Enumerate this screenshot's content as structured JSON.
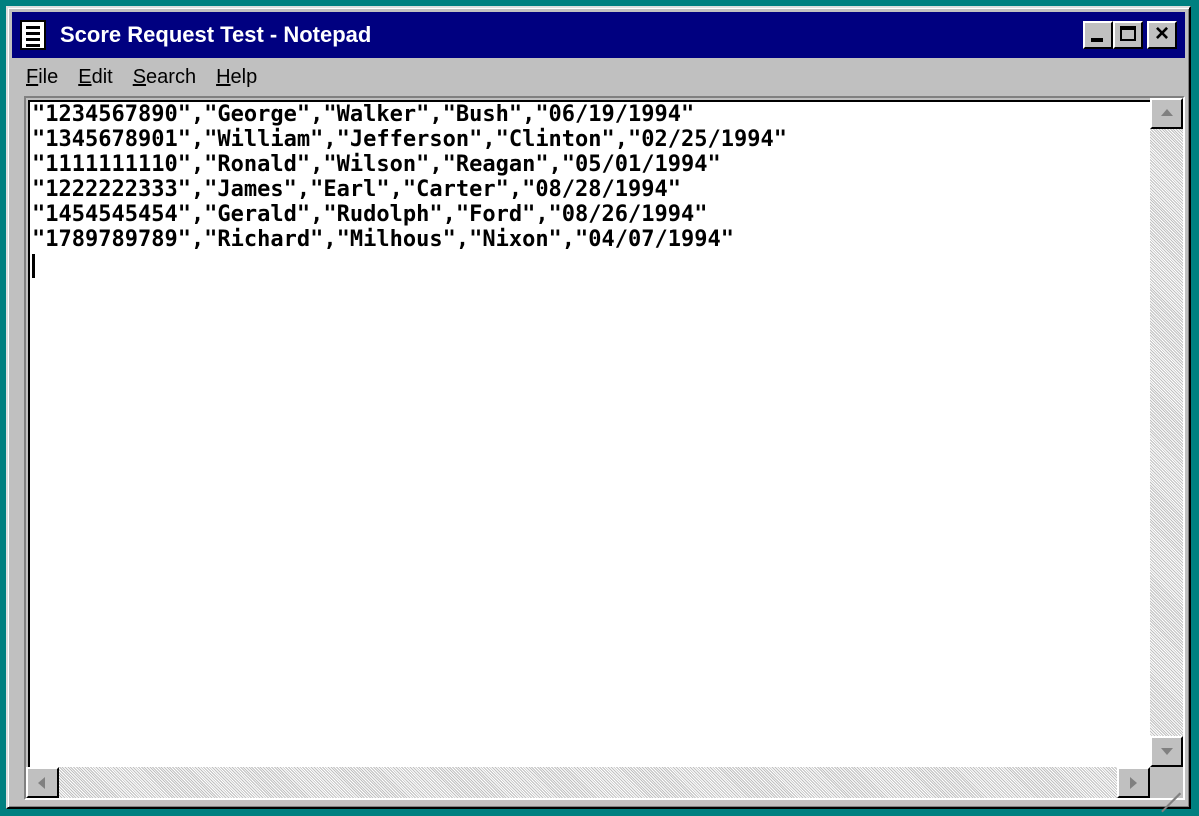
{
  "window": {
    "title": "Score Request Test - Notepad",
    "close_glyph": "×"
  },
  "menu": {
    "file_mnemonic": "F",
    "file_rest": "ile",
    "edit_mnemonic": "E",
    "edit_rest": "dit",
    "search_mnemonic": "S",
    "search_rest": "earch",
    "help_mnemonic": "H",
    "help_rest": "elp"
  },
  "editor": {
    "lines": [
      "\"1234567890\",\"George\",\"Walker\",\"Bush\",\"06/19/1994\"",
      "\"1345678901\",\"William\",\"Jefferson\",\"Clinton\",\"02/25/1994\"",
      "\"1111111110\",\"Ronald\",\"Wilson\",\"Reagan\",\"05/01/1994\"",
      "\"1222222333\",\"James\",\"Earl\",\"Carter\",\"08/28/1994\"",
      "\"1454545454\",\"Gerald\",\"Rudolph\",\"Ford\",\"08/26/1994\"",
      "\"1789789789\",\"Richard\",\"Milhous\",\"Nixon\",\"04/07/1994\""
    ]
  },
  "icons": {
    "app": "notepad-icon",
    "minimize": "minimize-icon",
    "maximize": "maximize-icon",
    "close": "close-icon"
  },
  "colors": {
    "titlebar": "#000080",
    "desktop": "#008080",
    "chrome": "#c0c0c0"
  }
}
